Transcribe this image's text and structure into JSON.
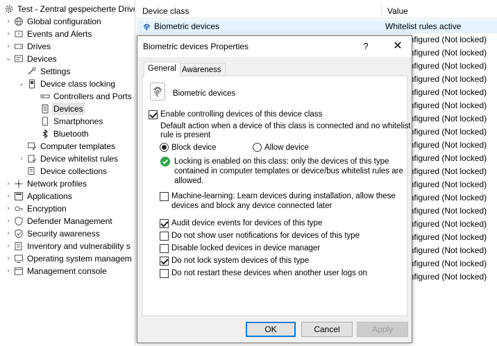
{
  "tree": {
    "items": [
      {
        "label": "Test - Zentral gespeicherte Drive",
        "expander": "",
        "icon": "gear-icon"
      },
      {
        "label": "Global configuration",
        "expander": "›",
        "icon": "globe-icon"
      },
      {
        "label": "Events and Alerts",
        "expander": "›",
        "icon": "alert-icon"
      },
      {
        "label": "Drives",
        "expander": "›",
        "icon": "drive-icon"
      },
      {
        "label": "Devices",
        "expander": "⌄",
        "icon": "devices-icon"
      },
      {
        "label": "Settings",
        "expander": "",
        "icon": "settings-icon"
      },
      {
        "label": "Device class locking",
        "expander": "⌄",
        "icon": "lock-device-icon"
      },
      {
        "label": "Controllers and Ports",
        "expander": "",
        "icon": "controller-icon"
      },
      {
        "label": "Devices",
        "expander": "",
        "icon": "device-icon"
      },
      {
        "label": "Smartphones",
        "expander": "",
        "icon": "smartphone-icon"
      },
      {
        "label": "Bluetooth",
        "expander": "",
        "icon": "bluetooth-icon"
      },
      {
        "label": "Computer templates",
        "expander": "",
        "icon": "template-icon"
      },
      {
        "label": "Device whitelist rules",
        "expander": "›",
        "icon": "whitelist-icon"
      },
      {
        "label": "Device collections",
        "expander": "",
        "icon": "collection-icon"
      },
      {
        "label": "Network profiles",
        "expander": "›",
        "icon": "network-icon"
      },
      {
        "label": "Applications",
        "expander": "›",
        "icon": "applications-icon"
      },
      {
        "label": "Encryption",
        "expander": "›",
        "icon": "encryption-icon"
      },
      {
        "label": "Defender Management",
        "expander": "›",
        "icon": "shield-icon"
      },
      {
        "label": "Security awareness",
        "expander": "›",
        "icon": "awareness-icon"
      },
      {
        "label": "Inventory and vulnerability s",
        "expander": "›",
        "icon": "inventory-icon"
      },
      {
        "label": "Operating system managem",
        "expander": "›",
        "icon": "os-icon"
      },
      {
        "label": "Management console",
        "expander": "›",
        "icon": "console-icon"
      }
    ]
  },
  "table": {
    "headers": [
      "Device class",
      "Value"
    ],
    "first_row": {
      "name": "Biometric devices",
      "value": "Whitelist rules active"
    },
    "rows": [
      "Not configured (Not locked)",
      "Not configured (Not locked)",
      "Not configured (Not locked)",
      "Not configured (Not locked)",
      "Not configured (Not locked)",
      "Not configured (Not locked)",
      "Not configured (Not locked)",
      "Not configured (Not locked)",
      "Not configured (Not locked)",
      "Not configured (Not locked)",
      "Not configured (Not locked)",
      "Not configured (Not locked)",
      "Not configured (Not locked)",
      "Not configured (Not locked)",
      "Not configured (Not locked)",
      "Not configured (Not locked)",
      "Not configured (Not locked)",
      "Not configured (Not locked)",
      "Not configured (Not locked)"
    ]
  },
  "dialog": {
    "title": "Biometric devices Properties",
    "help": "?",
    "close": "✕",
    "tabs": [
      "General",
      "Awareness"
    ],
    "device_name": "Biometric devices",
    "enable_label": "Enable controlling devices of this device class",
    "default_action_text_1": "Default action when a device of this class is connected and no whitelist",
    "default_action_text_2": "rule is present",
    "block_label": "Block device",
    "allow_label": "Allow device",
    "info_1": "Locking is enabled on this class: only the devices of this type",
    "info_2": "contained in computer templates or device/bus whitelist rules are",
    "info_3": "allowed.",
    "ml_label_1": "Machine-learning: Learn devices during installation, allow these",
    "ml_label_2": "devices and block any device connected later",
    "options": [
      {
        "label": "Audit device events for devices of this type",
        "checked": true
      },
      {
        "label": "Do not show user notifications for devices of this type",
        "checked": false
      },
      {
        "label": "Disable locked devices in device manager",
        "checked": false
      },
      {
        "label": "Do not lock system devices of this type",
        "checked": true
      },
      {
        "label": "Do not restart these devices when another user logs on",
        "checked": false
      }
    ],
    "buttons": {
      "ok": "OK",
      "cancel": "Cancel",
      "apply": "Apply"
    }
  }
}
